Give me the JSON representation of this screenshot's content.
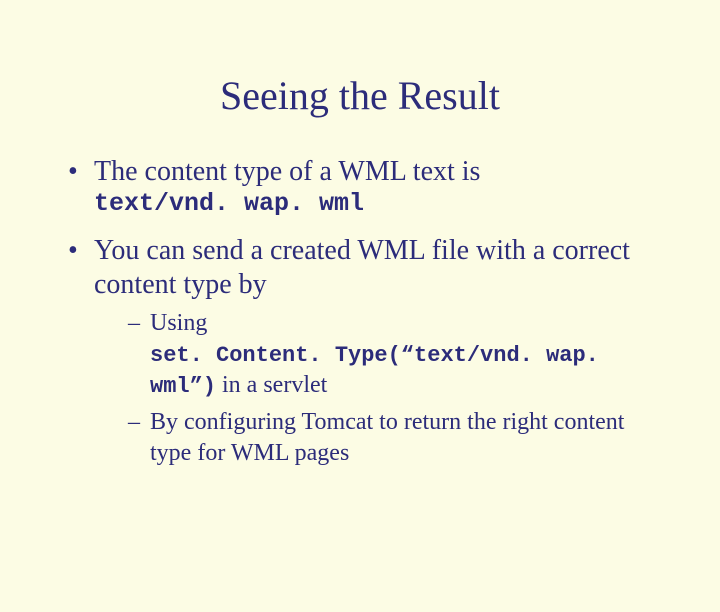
{
  "title": "Seeing the Result",
  "bullets": {
    "b1_lead": "The content type of a WML text is",
    "b1_mime": "text/vnd. wap. wml",
    "b2": "You can send a created WML file with a correct content type by"
  },
  "sub": {
    "s1_word": "Using",
    "s1_code": "set. Content. Type(“text/vnd. wap. wml”)",
    "s1_tail": " in a servlet",
    "s2": "By configuring Tomcat to return the right content type for WML pages"
  }
}
